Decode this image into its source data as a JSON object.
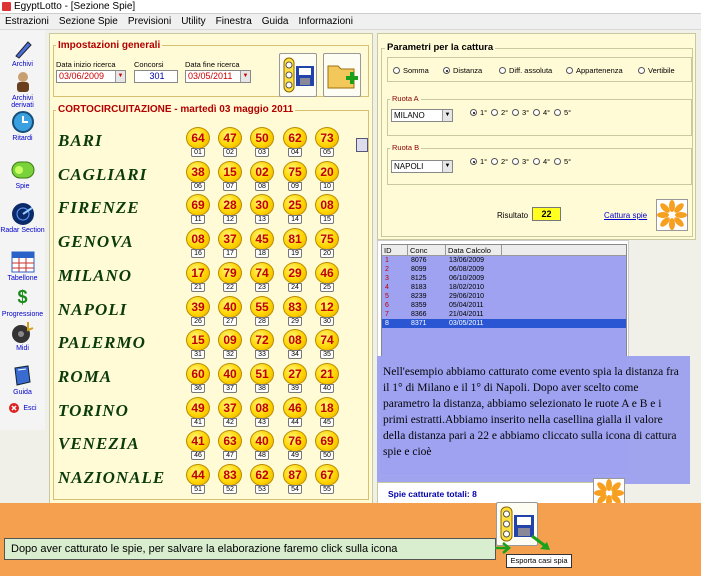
{
  "window": {
    "title": "EgyptLotto - [Sezione Spie]"
  },
  "menu": [
    "Estrazioni",
    "Sezione Spie",
    "Previsioni",
    "Utility",
    "Finestra",
    "Guida",
    "Informazioni"
  ],
  "sidebar": [
    {
      "label": "Archivi",
      "icon": "pen-icon"
    },
    {
      "label": "Archivi derivati",
      "icon": "person-icon"
    },
    {
      "label": "Ritardi",
      "icon": "clock-icon"
    },
    {
      "label": "Spie",
      "icon": "traffic-light-icon"
    },
    {
      "label": "Radar Section",
      "icon": "radar-icon"
    },
    {
      "label": "Tabellone",
      "icon": "calendar-icon"
    },
    {
      "label": "Progressione",
      "icon": "dollar-icon"
    },
    {
      "label": "Midi",
      "icon": "music-icon"
    },
    {
      "label": "Guida",
      "icon": "book-icon"
    },
    {
      "label": "Esci",
      "icon": "exit-icon"
    }
  ],
  "settings": {
    "title": "Impostazioni generali",
    "start_label": "Data inizio ricerca",
    "start_value": "03/06/2009",
    "draws_label": "Concorsi",
    "draws_value": "301",
    "end_label": "Data fine ricerca",
    "end_value": "03/05/2011"
  },
  "draw_title": "CORTOCIRCUITAZIONE - martedì 03 maggio 2011",
  "wheels": [
    {
      "name": "BARI",
      "nums": [
        "64",
        "47",
        "50",
        "62",
        "73"
      ],
      "pos": [
        "01",
        "02",
        "03",
        "04",
        "05"
      ]
    },
    {
      "name": "CAGLIARI",
      "nums": [
        "38",
        "15",
        "02",
        "75",
        "20"
      ],
      "pos": [
        "06",
        "07",
        "08",
        "09",
        "10"
      ]
    },
    {
      "name": "FIRENZE",
      "nums": [
        "69",
        "28",
        "30",
        "25",
        "08"
      ],
      "pos": [
        "11",
        "12",
        "13",
        "14",
        "15"
      ]
    },
    {
      "name": "GENOVA",
      "nums": [
        "08",
        "37",
        "45",
        "81",
        "75"
      ],
      "pos": [
        "16",
        "17",
        "18",
        "19",
        "20"
      ]
    },
    {
      "name": "MILANO",
      "nums": [
        "17",
        "79",
        "74",
        "29",
        "46"
      ],
      "pos": [
        "21",
        "22",
        "23",
        "24",
        "25"
      ]
    },
    {
      "name": "NAPOLI",
      "nums": [
        "39",
        "40",
        "55",
        "83",
        "12"
      ],
      "pos": [
        "26",
        "27",
        "28",
        "29",
        "30"
      ]
    },
    {
      "name": "PALERMO",
      "nums": [
        "15",
        "09",
        "72",
        "08",
        "74"
      ],
      "pos": [
        "31",
        "32",
        "33",
        "34",
        "35"
      ]
    },
    {
      "name": "ROMA",
      "nums": [
        "60",
        "40",
        "51",
        "27",
        "21"
      ],
      "pos": [
        "36",
        "37",
        "38",
        "39",
        "40"
      ]
    },
    {
      "name": "TORINO",
      "nums": [
        "49",
        "37",
        "08",
        "46",
        "18"
      ],
      "pos": [
        "41",
        "42",
        "43",
        "44",
        "45"
      ]
    },
    {
      "name": "VENEZIA",
      "nums": [
        "41",
        "63",
        "40",
        "76",
        "69"
      ],
      "pos": [
        "46",
        "47",
        "48",
        "49",
        "50"
      ]
    },
    {
      "name": "NAZIONALE",
      "nums": [
        "44",
        "83",
        "62",
        "87",
        "67"
      ],
      "pos": [
        "51",
        "52",
        "53",
        "54",
        "55"
      ]
    }
  ],
  "params": {
    "title": "Parametri per la cattura",
    "modes": [
      "Somma",
      "Distanza",
      "Diff. assoluta",
      "Appartenenza",
      "Vertibile"
    ],
    "selected_mode": 1,
    "ruota_a_title": "Ruota A",
    "ruota_a_value": "MILANO",
    "ruota_b_title": "Ruota B",
    "ruota_b_value": "NAPOLI",
    "positions": [
      "1°",
      "2°",
      "3°",
      "4°",
      "5°"
    ],
    "result_label": "Risultato",
    "result_value": "22",
    "capture_label": "Cattura spie"
  },
  "table": {
    "headers": [
      "ID",
      "Conc",
      "Data Calcolo"
    ],
    "rows": [
      [
        "1",
        "8076",
        "13/06/2009"
      ],
      [
        "2",
        "8099",
        "06/08/2009"
      ],
      [
        "3",
        "8125",
        "06/10/2009"
      ],
      [
        "4",
        "8183",
        "18/02/2010"
      ],
      [
        "5",
        "8239",
        "29/06/2010"
      ],
      [
        "6",
        "8359",
        "05/04/2011"
      ],
      [
        "7",
        "8366",
        "21/04/2011"
      ],
      [
        "8",
        "8371",
        "03/05/2011"
      ]
    ],
    "selected_row": 7
  },
  "note": "Nell'esempio abbiamo catturato come evento spia la distanza fra il 1° di Milano e il 1° di Napoli. Dopo aver scelto come parametro la distanza, abbiamo selezionato le ruote A e B e i primi estratti.Abbiamo inserito nella casellina gialla il valore della distanza pari a 22 e abbiamo cliccato sulla icona di cattura spie e cioè",
  "spie_total": "Spie catturate totali: 8",
  "caption": "Dopo aver catturato le spie, per salvare la elaborazione faremo click sulla icona",
  "tooltip": "Esporta casi spia",
  "colors": {
    "panel": "#fffbd6",
    "bulb": "#ffd400",
    "table": "#9ea2f0",
    "banner": "#f5a04f",
    "number": "#c00000"
  }
}
